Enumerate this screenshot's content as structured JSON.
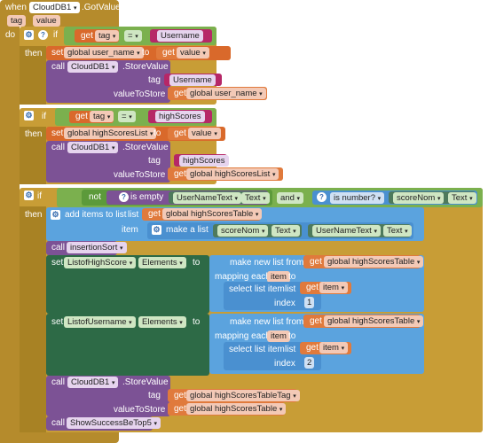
{
  "event": {
    "when": "when",
    "component": "CloudDB1",
    "event_name": ".GotValue",
    "params": [
      "tag",
      "value"
    ],
    "do": "do"
  },
  "kw": {
    "if": "if",
    "then": "then",
    "call": "call",
    "set": "set",
    "to": "to",
    "get": "get",
    "eq": "=",
    "not": "not",
    "is_empty": "is empty",
    "and": "and",
    "is_number": "is number?",
    "add_items": "add items to list",
    "list": "list",
    "item": "item",
    "make_a_list": "make a list",
    "make_new_list_from": "make new list from",
    "mapping_each": "mapping each",
    "select_list_item": "select list item",
    "index": "index",
    "tag": "tag",
    "value_to_store": "valueToStore",
    "elements": "Elements"
  },
  "if1": {
    "get_tag": "tag",
    "string": "Username",
    "set_var": "global user_name",
    "get_value": "value",
    "call_comp": "CloudDB1",
    "call_method": ".StoreValue",
    "tag_str": "Username",
    "store_get": "global user_name"
  },
  "if2": {
    "get_tag": "tag",
    "string": "highScores",
    "set_var": "global highScoresList",
    "get_value": "value",
    "call_comp": "CloudDB1",
    "call_method": ".StoreValue",
    "tag_str": "highScores",
    "store_get": "global highScoresList"
  },
  "if3": {
    "uname_comp": "UserNameText",
    "text_prop": "Text",
    "score_comp": "scoreNom",
    "text_prop2": "Text",
    "list_var": "global highScoresTable",
    "ml_score": "scoreNom",
    "ml_text": "Text",
    "ml_uname": "UserNameText",
    "ml_text2": "Text",
    "proc": "insertionSort",
    "set1_comp": "ListofHighScore",
    "map1_list": "global highScoresTable",
    "map1_item": "item",
    "sel1_item": "item",
    "idx1": "1",
    "set2_comp": "ListofUsername",
    "map2_list": "global highScoresTable",
    "map2_item": "item",
    "sel2_item": "item",
    "idx2": "2",
    "call_comp": "CloudDB1",
    "call_method": ".StoreValue",
    "tag_get": "global highScoresTableTag",
    "store_get": "global highScoresTable",
    "proc2": "ShowSuccessBeTop5"
  }
}
